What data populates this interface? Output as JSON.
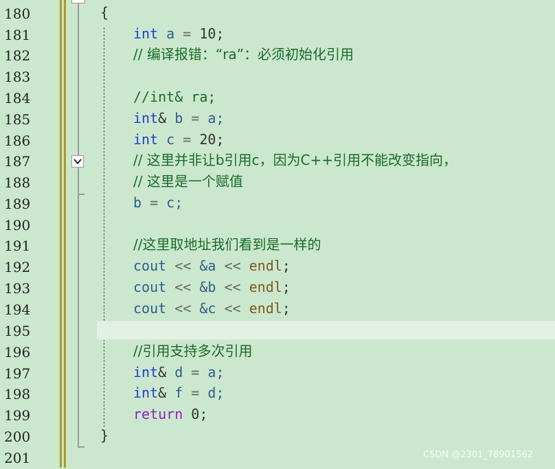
{
  "editor": {
    "line_numbers": [
      "180",
      "181",
      "182",
      "183",
      "184",
      "185",
      "186",
      "187",
      "188",
      "189",
      "190",
      "191",
      "192",
      "193",
      "194",
      "195",
      "196",
      "197",
      "198",
      "199",
      "200",
      "201"
    ],
    "lines": {
      "l180": {
        "brace_open": "{"
      },
      "l181": {
        "kw": "int",
        "rest_a": " a ",
        "op": "=",
        "rest_b": " 10;"
      },
      "l182": {
        "comment": "// 编译报错：“ra”：必须初始化引用"
      },
      "l184": {
        "comment": "//int& ra;"
      },
      "l185": {
        "kw": "int",
        "amp": "&",
        "var": " b ",
        "op": "=",
        "rest": " a;"
      },
      "l186": {
        "kw": "int",
        "rest_a": " c ",
        "op": "=",
        "rest_b": " 20;"
      },
      "l187": {
        "comment": "// 这里并非让b引用c，因为C++引用不能改变指向，"
      },
      "l188": {
        "comment": "// 这里是一个赋值"
      },
      "l189": {
        "var_b": "b",
        "op": " = ",
        "var_c": "c;"
      },
      "l191": {
        "comment": "//这里取地址我们看到是一样的"
      },
      "l192": {
        "cout": "cout ",
        "shift1": "<<",
        "addr": " &a ",
        "shift2": "<<",
        "endl": " endl",
        "semi": ";"
      },
      "l193": {
        "cout": "cout ",
        "shift1": "<<",
        "addr": " &b ",
        "shift2": "<<",
        "endl": " endl",
        "semi": ";"
      },
      "l194": {
        "cout": "cout ",
        "shift1": "<<",
        "addr": " &c ",
        "shift2": "<<",
        "endl": " endl",
        "semi": ";"
      },
      "l196": {
        "comment": "//引用支持多次引用"
      },
      "l197": {
        "kw": "int",
        "amp": "&",
        "var": " d ",
        "op": "=",
        "rest": " a;"
      },
      "l198": {
        "kw": "int",
        "amp": "&",
        "var": " f ",
        "op": "=",
        "rest": " d;"
      },
      "l199": {
        "kw": "return",
        "rest": " 0;"
      },
      "l200": {
        "brace_close": "}"
      }
    },
    "fold_box_icon": "chevron-down-icon",
    "current_line": "195"
  },
  "watermark": "CSDN @2301_78901562",
  "colors": {
    "background": "#cbe8cf",
    "keyword": "#1f3fd1",
    "return_keyword": "#8a21c4",
    "comment": "#1b6a2a",
    "gutter_marker": "#b09a1e"
  }
}
